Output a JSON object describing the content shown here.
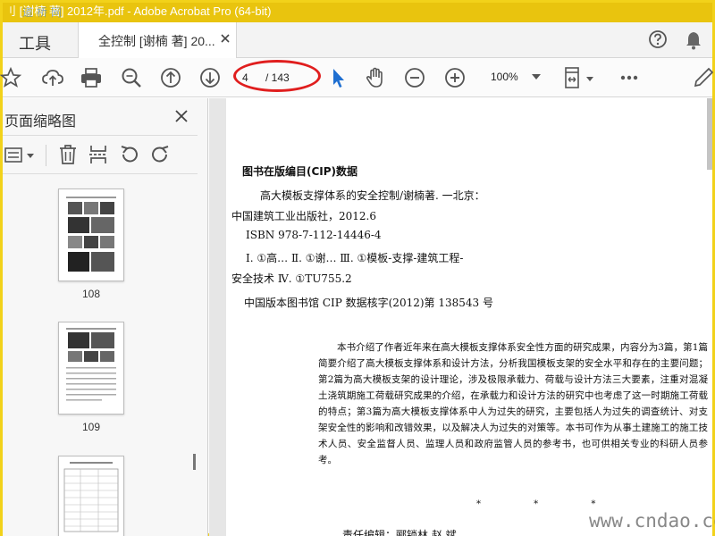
{
  "window": {
    "title": "刂 [谢楠 著] 2012年.pdf - Adobe Acrobat Pro (64-bit)"
  },
  "watermarks": {
    "top": "道桥网",
    "bottom": "www.cndao.com"
  },
  "tabs": {
    "tools_label": "工具",
    "document_label": "全控制 [谢楠 著] 20..."
  },
  "toolbar": {
    "current_page": "4",
    "total_pages": "/ 143",
    "zoom": "100%"
  },
  "panel": {
    "title": "页面缩略图",
    "thumbnails": [
      {
        "label": "108"
      },
      {
        "label": "109"
      },
      {
        "label": ""
      }
    ]
  },
  "document": {
    "cip_title": "图书在版编目(CIP)数据",
    "cip_lines": [
      "高大模板支撑体系的安全控制/谢楠著. 一北京：",
      "中国建筑工业出版社，2012.6",
      "ISBN 978-7-112-14446-4",
      "Ⅰ. ①高…  Ⅱ. ①谢…  Ⅲ. ①模板-支撑-建筑工程-",
      "安全技术  Ⅳ. ①TU755.2",
      "中国版本图书馆 CIP 数据核字(2012)第 138543 号"
    ],
    "summary": "本书介绍了作者近年来在高大模板支撑体系安全性方面的研究成果，内容分为3篇，第1篇简要介绍了高大模板支撑体系和设计方法，分析我国模板支架的安全水平和存在的主要问题；第2篇为高大模板支架的设计理论，涉及极限承载力、荷载与设计方法三大要素，注重对混凝土浇筑期施工荷载研究成果的介绍，在承载力和设计方法的研究中也考虑了这一时期施工荷载的特点；第3篇为高大模板支撑体系中人为过失的研究，主要包括人为过失的调查统计、对支架安全性的影响和改错效果，以及解决人为过失的对策等。本书可作为从事土建施工的施工技术人员、安全监督人员、监理人员和政府监管人员的参考书，也可供相关专业的科研人员参考。",
    "stars": "* * *",
    "editor_line": "责任编辑：郦锁林  赵  斌"
  },
  "colors": {
    "title_bar": "#e9c40e",
    "accent_blue": "#1f6fd1",
    "annotation_red": "#e01e1e"
  }
}
